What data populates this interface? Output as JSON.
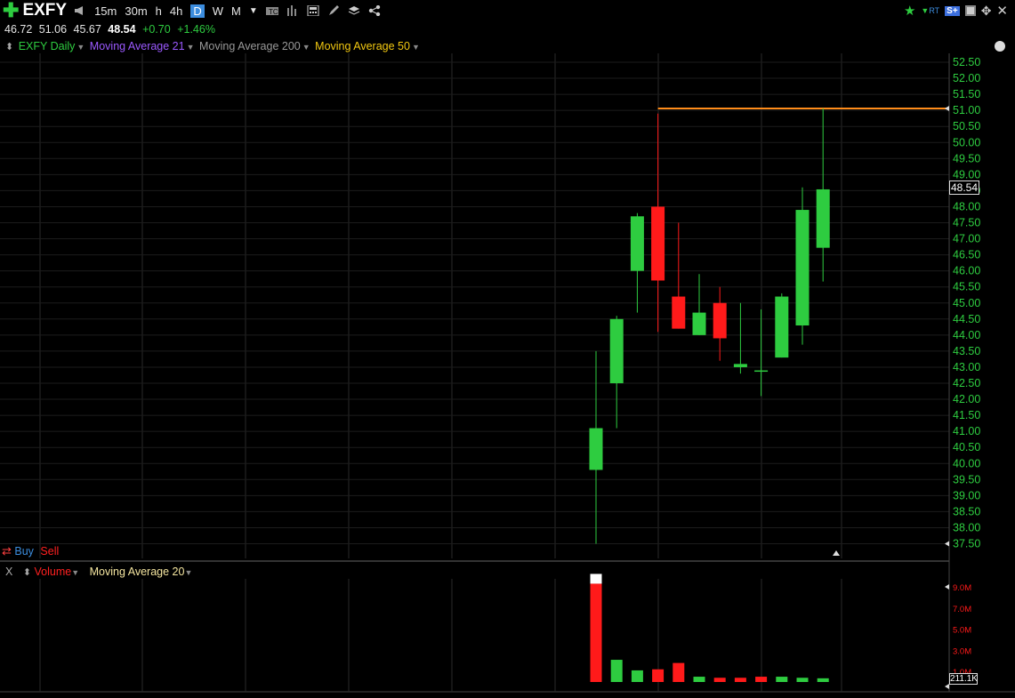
{
  "toolbar": {
    "symbol": "EXFY",
    "timeframes": [
      "15m",
      "30m",
      "h",
      "4h",
      "D",
      "W",
      "M"
    ],
    "active_timeframe": "D",
    "rt_label": "RT",
    "social_label": "S+"
  },
  "quote": {
    "open": "46.72",
    "high": "51.06",
    "low": "45.67",
    "last": "48.54",
    "change": "+0.70",
    "change_pct": "+1.46%"
  },
  "legend": {
    "series": "EXFY Daily",
    "ma21": "Moving Average 21",
    "ma200": "Moving Average 200",
    "ma50": "Moving Average 50"
  },
  "buysell": {
    "buy": "Buy",
    "sell": "Sell"
  },
  "volume_legend": {
    "close": "X",
    "volume": "Volume",
    "ma": "Moving Average 20"
  },
  "badges": {
    "price": "48.54",
    "volume": "211.1K"
  },
  "colors": {
    "up": "#2ecc40",
    "down": "#ff1a1a",
    "hline": "#ff8c1a",
    "axis_text": "#2ecc40",
    "ma21": "#9b59ff",
    "ma200": "#999999",
    "ma50": "#f2c811",
    "volume_down": "#ff1a1a",
    "volume_up": "#2ecc40"
  },
  "chart_data": [
    {
      "type": "candlestick",
      "title": "EXFY Daily",
      "ylim": [
        37.25,
        52.75
      ],
      "yticks": [
        "52.50",
        "52.00",
        "51.50",
        "51.00",
        "50.50",
        "50.00",
        "49.50",
        "49.00",
        "48.50",
        "48.00",
        "47.50",
        "47.00",
        "46.50",
        "46.00",
        "45.50",
        "45.00",
        "44.50",
        "44.00",
        "43.50",
        "43.00",
        "42.50",
        "42.00",
        "41.50",
        "41.00",
        "40.50",
        "40.00",
        "39.50",
        "39.00",
        "38.50",
        "38.00",
        "37.50"
      ],
      "candles": [
        {
          "o": 39.8,
          "h": 43.5,
          "l": 37.5,
          "c": 41.1
        },
        {
          "o": 42.5,
          "h": 44.6,
          "l": 41.1,
          "c": 44.5
        },
        {
          "o": 46.0,
          "h": 47.8,
          "l": 44.7,
          "c": 47.7
        },
        {
          "o": 48.0,
          "h": 50.9,
          "l": 44.1,
          "c": 45.7
        },
        {
          "o": 45.2,
          "h": 47.5,
          "l": 44.2,
          "c": 44.2
        },
        {
          "o": 44.0,
          "h": 45.9,
          "l": 44.0,
          "c": 44.7
        },
        {
          "o": 45.0,
          "h": 45.5,
          "l": 43.2,
          "c": 43.9
        },
        {
          "o": 43.0,
          "h": 45.0,
          "l": 42.8,
          "c": 43.1
        },
        {
          "o": 42.9,
          "h": 44.8,
          "l": 42.1,
          "c": 42.9
        },
        {
          "o": 43.3,
          "h": 45.3,
          "l": 43.3,
          "c": 45.2
        },
        {
          "o": 44.3,
          "h": 48.6,
          "l": 43.7,
          "c": 47.9
        },
        {
          "o": 46.72,
          "h": 51.06,
          "l": 45.67,
          "c": 48.54
        }
      ],
      "horizontal_line": {
        "value": 51.06,
        "from_candle": 3
      }
    },
    {
      "type": "bar",
      "title": "Volume",
      "yticks": [
        "9.0M",
        "7.0M",
        "5.0M",
        "3.0M",
        "1.0M"
      ],
      "ylim": [
        0,
        9.3
      ],
      "values": [
        9.3,
        2.1,
        1.1,
        1.2,
        1.8,
        0.5,
        0.4,
        0.4,
        0.5,
        0.5,
        0.4,
        0.35
      ],
      "colors": [
        "down",
        "up",
        "up",
        "down",
        "down",
        "up",
        "down",
        "down",
        "down",
        "up",
        "up",
        "up"
      ]
    }
  ]
}
